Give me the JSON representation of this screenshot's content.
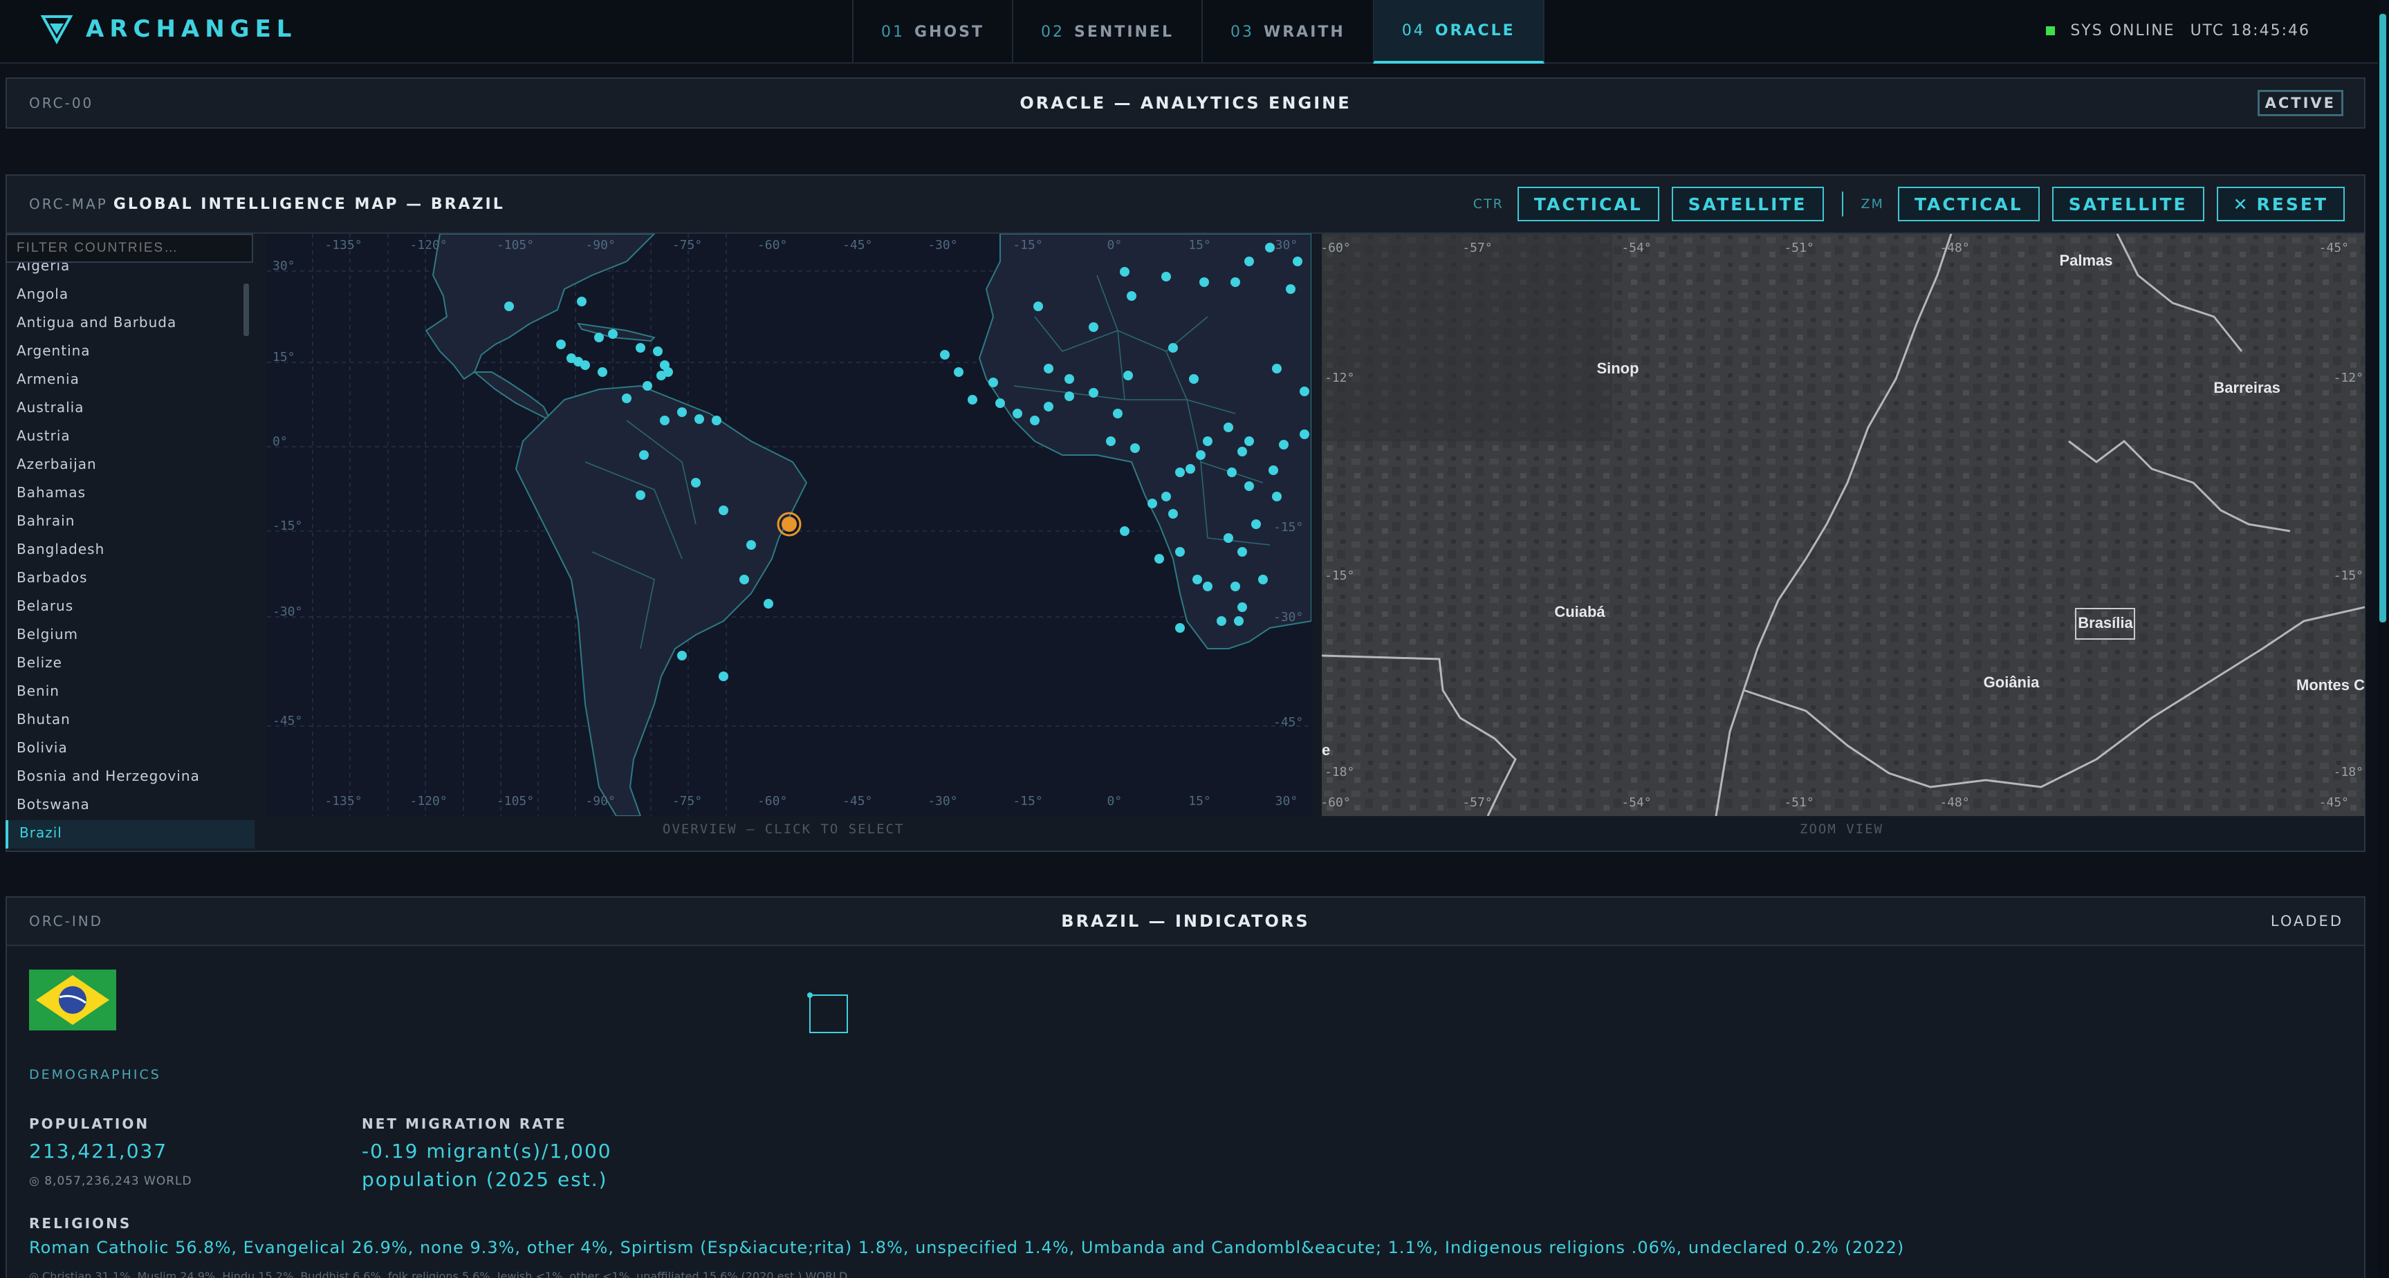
{
  "app": {
    "name": "ARCHANGEL"
  },
  "tabs": [
    {
      "num": "01",
      "label": "GHOST"
    },
    {
      "num": "02",
      "label": "SENTINEL"
    },
    {
      "num": "03",
      "label": "WRAITH"
    },
    {
      "num": "04",
      "label": "ORACLE"
    }
  ],
  "system": {
    "status": "SYS ONLINE",
    "clock": "UTC 18:45:46"
  },
  "oracle_panel": {
    "code": "ORC-00",
    "title": "ORACLE — ANALYTICS ENGINE",
    "status": "ACTIVE"
  },
  "map_panel": {
    "code": "ORC-MAP",
    "title": "GLOBAL INTELLIGENCE MAP — BRAZIL",
    "ctr_label": "CTR",
    "zm_label": "ZM",
    "tactical": "TACTICAL",
    "satellite": "SATELLITE",
    "reset": "RESET",
    "filter_placeholder": "FILTER COUNTRIES…",
    "countries": [
      "Algeria",
      "Angola",
      "Antigua and Barbuda",
      "Argentina",
      "Armenia",
      "Australia",
      "Austria",
      "Azerbaijan",
      "Bahamas",
      "Bahrain",
      "Bangladesh",
      "Barbados",
      "Belarus",
      "Belgium",
      "Belize",
      "Benin",
      "Bhutan",
      "Bolivia",
      "Bosnia and Herzegovina",
      "Botswana",
      "Brazil"
    ],
    "selected_country": "Brazil",
    "overview_caption": "OVERVIEW — CLICK TO SELECT",
    "zoom_caption": "ZOOM VIEW",
    "overview_lon_ticks": [
      "-135°",
      "-120°",
      "-105°",
      "-90°",
      "-75°",
      "-60°",
      "-45°",
      "-30°",
      "-15°",
      "0°",
      "15°",
      "30°"
    ],
    "overview_lat_ticks": [
      "30°",
      "15°",
      "0°",
      "-15°",
      "-30°",
      "-45°"
    ],
    "overview_lat_ticks_right": [
      "-15°",
      "-30°",
      "-45°"
    ],
    "zoom_lon_ticks": [
      "-60°",
      "-57°",
      "-54°",
      "-51°",
      "-48°",
      "-45°"
    ],
    "zoom_lat_ticks": [
      "-12°",
      "-15°",
      "-18°"
    ],
    "zoom_places": [
      "Palmas",
      "Sinop",
      "Barreiras",
      "Cuiabá",
      "Brasília",
      "Goiânia",
      "Montes C"
    ],
    "zoom_edge_letter": "e"
  },
  "indicators": {
    "code": "ORC-IND",
    "title": "BRAZIL — INDICATORS",
    "status": "LOADED",
    "section": "DEMOGRAPHICS",
    "population_label": "POPULATION",
    "population_value": "213,421,037",
    "population_world": "◎ 8,057,236,243 WORLD",
    "migration_label": "NET MIGRATION RATE",
    "migration_value_line1": "-0.19 migrant(s)/1,000",
    "migration_value_line2": "population (2025 est.)",
    "religions_label": "RELIGIONS",
    "religions_value": "Roman Catholic 56.8%, Evangelical 26.9%, none 9.3%, other 4%, Spirtism (Esp&iacute;rita) 1.8%, unspecified 1.4%, Umbanda and Candombl&eacute; 1.1%, Indigenous religions .06%, undeclared 0.2% (2022)",
    "religions_world": "◎ Christian 31.1%, Muslim 24.9%, Hindu 15.2%, Buddhist 6.6%, folk religions 5.6%, Jewish <1%, other <1%, unaffiliated 15.6% (2020 est.) WORLD"
  },
  "colors": {
    "accent": "#3fd2e0",
    "background": "#0d1119",
    "panel": "#141a23",
    "status_dot": "#3be04a",
    "selected_marker": "#e8962a"
  }
}
